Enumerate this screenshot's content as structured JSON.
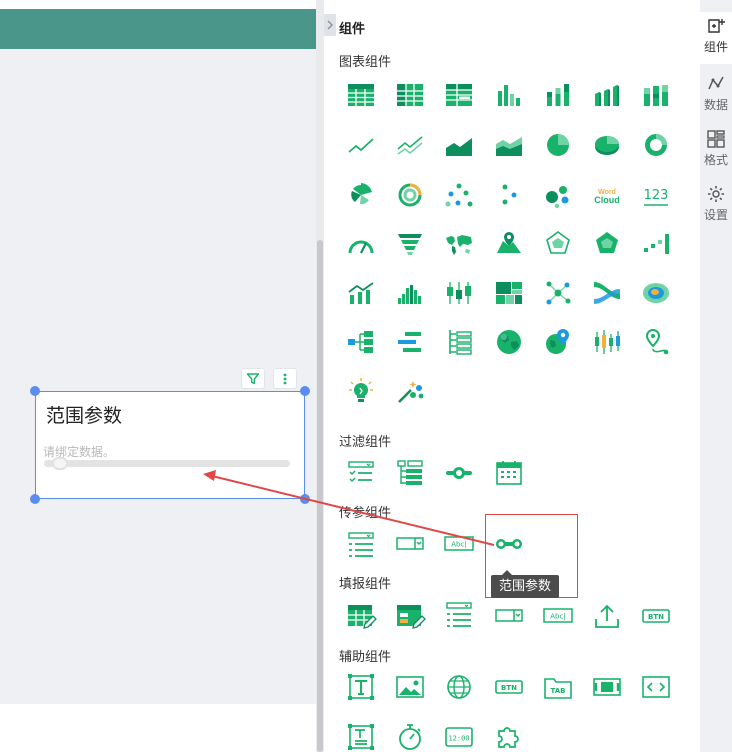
{
  "canvas": {
    "widget_title": "范围参数",
    "widget_placeholder": "请绑定数据。"
  },
  "panel": {
    "title": "组件",
    "sections": {
      "chart": "图表组件",
      "filter": "过滤组件",
      "param": "传参组件",
      "form": "填报组件",
      "aux": "辅助组件"
    },
    "tooltip": "范围参数"
  },
  "icon_text": {
    "word": "Word",
    "cloud": "Cloud",
    "num": "123",
    "abc": "Abc|",
    "btn": "BTN",
    "tab": "TAB",
    "time": "12:00"
  },
  "rail": {
    "components": "组件",
    "data": "数据",
    "format": "格式",
    "settings": "设置"
  },
  "colors": {
    "primary": "#19b26b",
    "dark": "#0d8f5d",
    "light": "#6fd3a5",
    "header": "#4a968a",
    "selection": "#5b8def",
    "hover_border": "#e04848"
  }
}
